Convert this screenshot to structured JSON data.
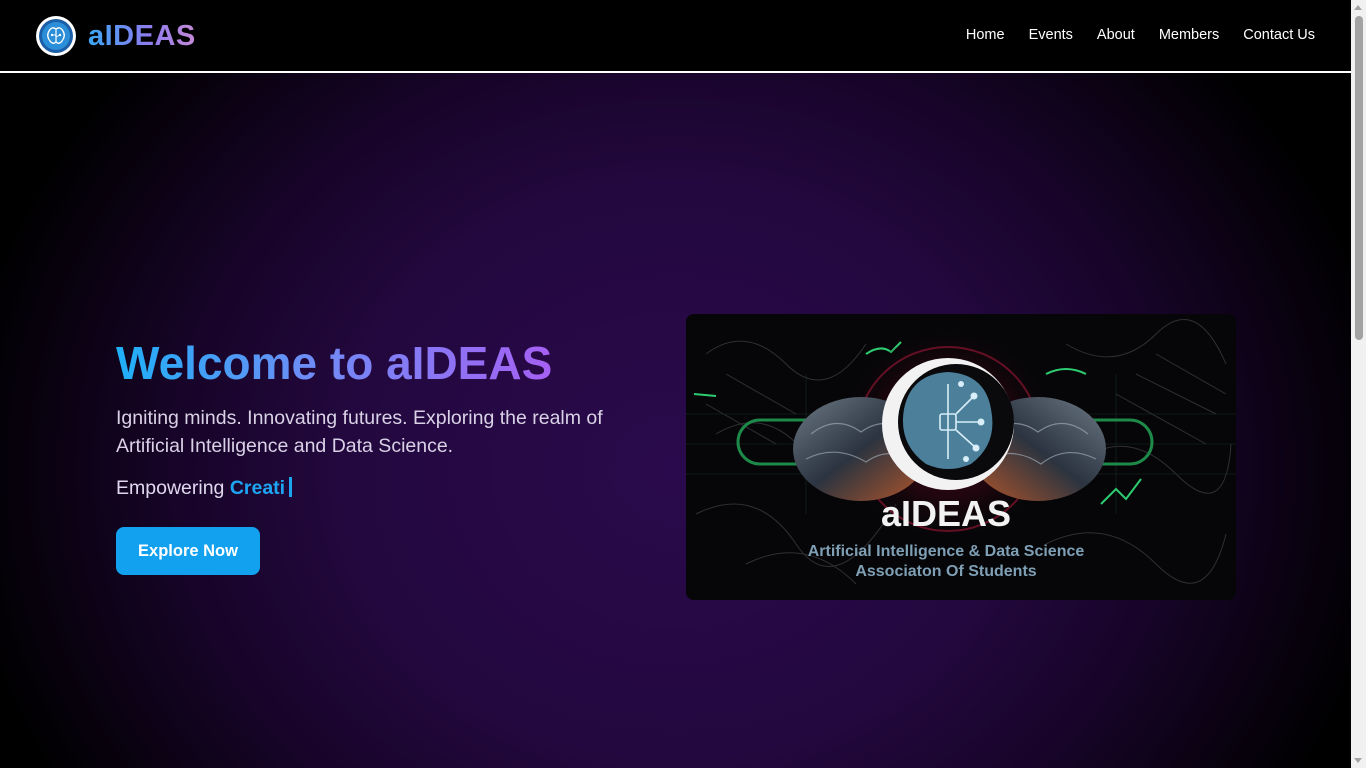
{
  "brand": {
    "name": "aIDEAS",
    "logo_icon": "brain-circuit-icon"
  },
  "nav": {
    "items": [
      {
        "label": "Home"
      },
      {
        "label": "Events"
      },
      {
        "label": "About"
      },
      {
        "label": "Members"
      },
      {
        "label": "Contact Us"
      }
    ]
  },
  "hero": {
    "title": "Welcome to aIDEAS",
    "subtitle": "Igniting minds. Innovating futures. Exploring the realm of Artificial Intelligence and Data Science.",
    "typed_prefix": "Empowering",
    "typed_word": "Creati",
    "cta_label": "Explore Now",
    "image": {
      "logo_text": "aIDEAS",
      "caption_line1": "Artificial Intelligence & Data Science",
      "caption_line2": "Associaton Of Students"
    }
  },
  "colors": {
    "accent": "#12a1ef",
    "title_gradient_start": "#1fb0f7",
    "title_gradient_end": "#a560f3",
    "background_glow": "#2a0a4c"
  }
}
